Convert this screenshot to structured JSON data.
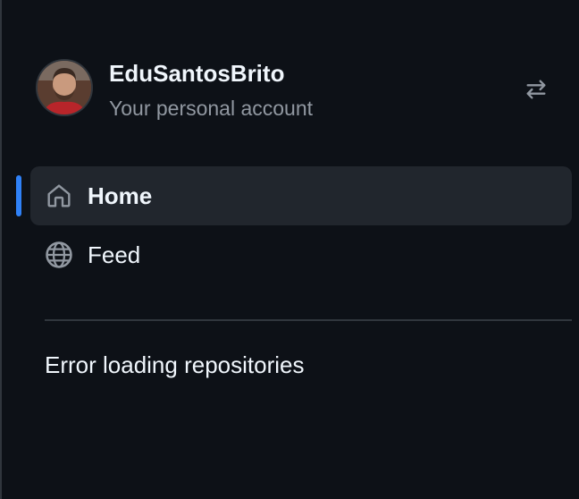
{
  "account": {
    "name": "EduSantosBrito",
    "subtitle": "Your personal account"
  },
  "icons": {
    "switch": "arrow-switch-icon",
    "home": "home-icon",
    "feed": "globe-icon"
  },
  "nav": {
    "items": [
      {
        "label": "Home",
        "active": true
      },
      {
        "label": "Feed",
        "active": false
      }
    ]
  },
  "repositories": {
    "status": "Error loading repositories"
  },
  "colors": {
    "background": "#0d1117",
    "active_bg": "#21262d",
    "accent": "#2f81f7",
    "text": "#f0f6fc",
    "muted": "#9198a1",
    "border": "#30363d"
  }
}
